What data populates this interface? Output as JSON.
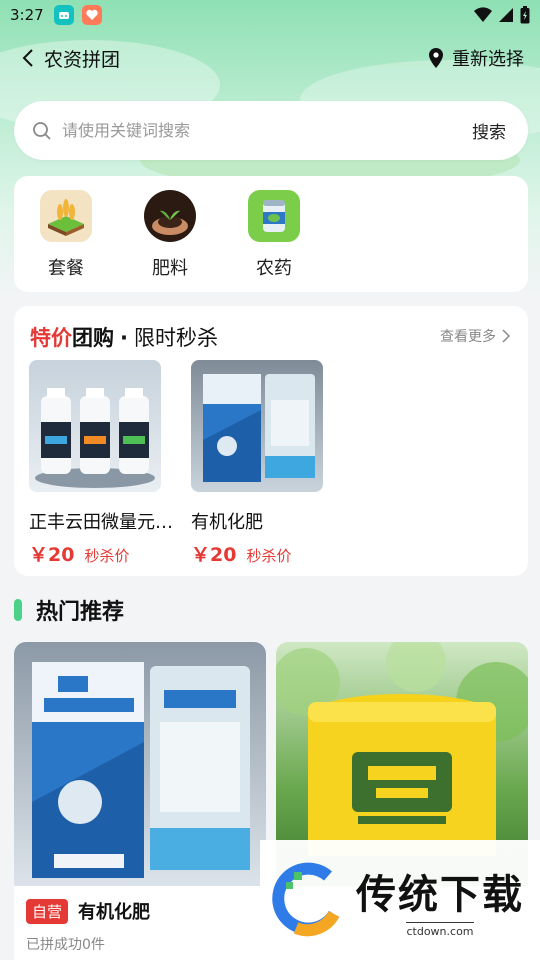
{
  "status_bar": {
    "time": "3:27"
  },
  "nav": {
    "title": "农资拼团",
    "location_label": "重新选择"
  },
  "search": {
    "placeholder": "请使用关键词搜索",
    "button": "搜索"
  },
  "categories": [
    {
      "label": "套餐",
      "icon": "grain-field-icon"
    },
    {
      "label": "肥料",
      "icon": "soil-hands-icon"
    },
    {
      "label": "农药",
      "icon": "pesticide-can-icon"
    }
  ],
  "deal": {
    "title_red": "特价",
    "title_black": "团购",
    "separator": "·",
    "subtitle": "限时秒杀",
    "more": "查看更多",
    "items": [
      {
        "name": "正丰云田微量元素...",
        "price": "￥20",
        "price_tag": "秒杀价"
      },
      {
        "name": "有机化肥",
        "price": "￥20",
        "price_tag": "秒杀价"
      }
    ]
  },
  "hot": {
    "title": "热门推荐",
    "items": [
      {
        "badge": "自营",
        "name": "有机化肥",
        "sold": "已拼成功0件"
      }
    ]
  },
  "watermark": {
    "main": "传统下载",
    "url": "ctdown.com"
  },
  "colors": {
    "accent_red": "#e53935",
    "accent_green": "#4cd18a",
    "header_green": "#8fe0b4"
  }
}
